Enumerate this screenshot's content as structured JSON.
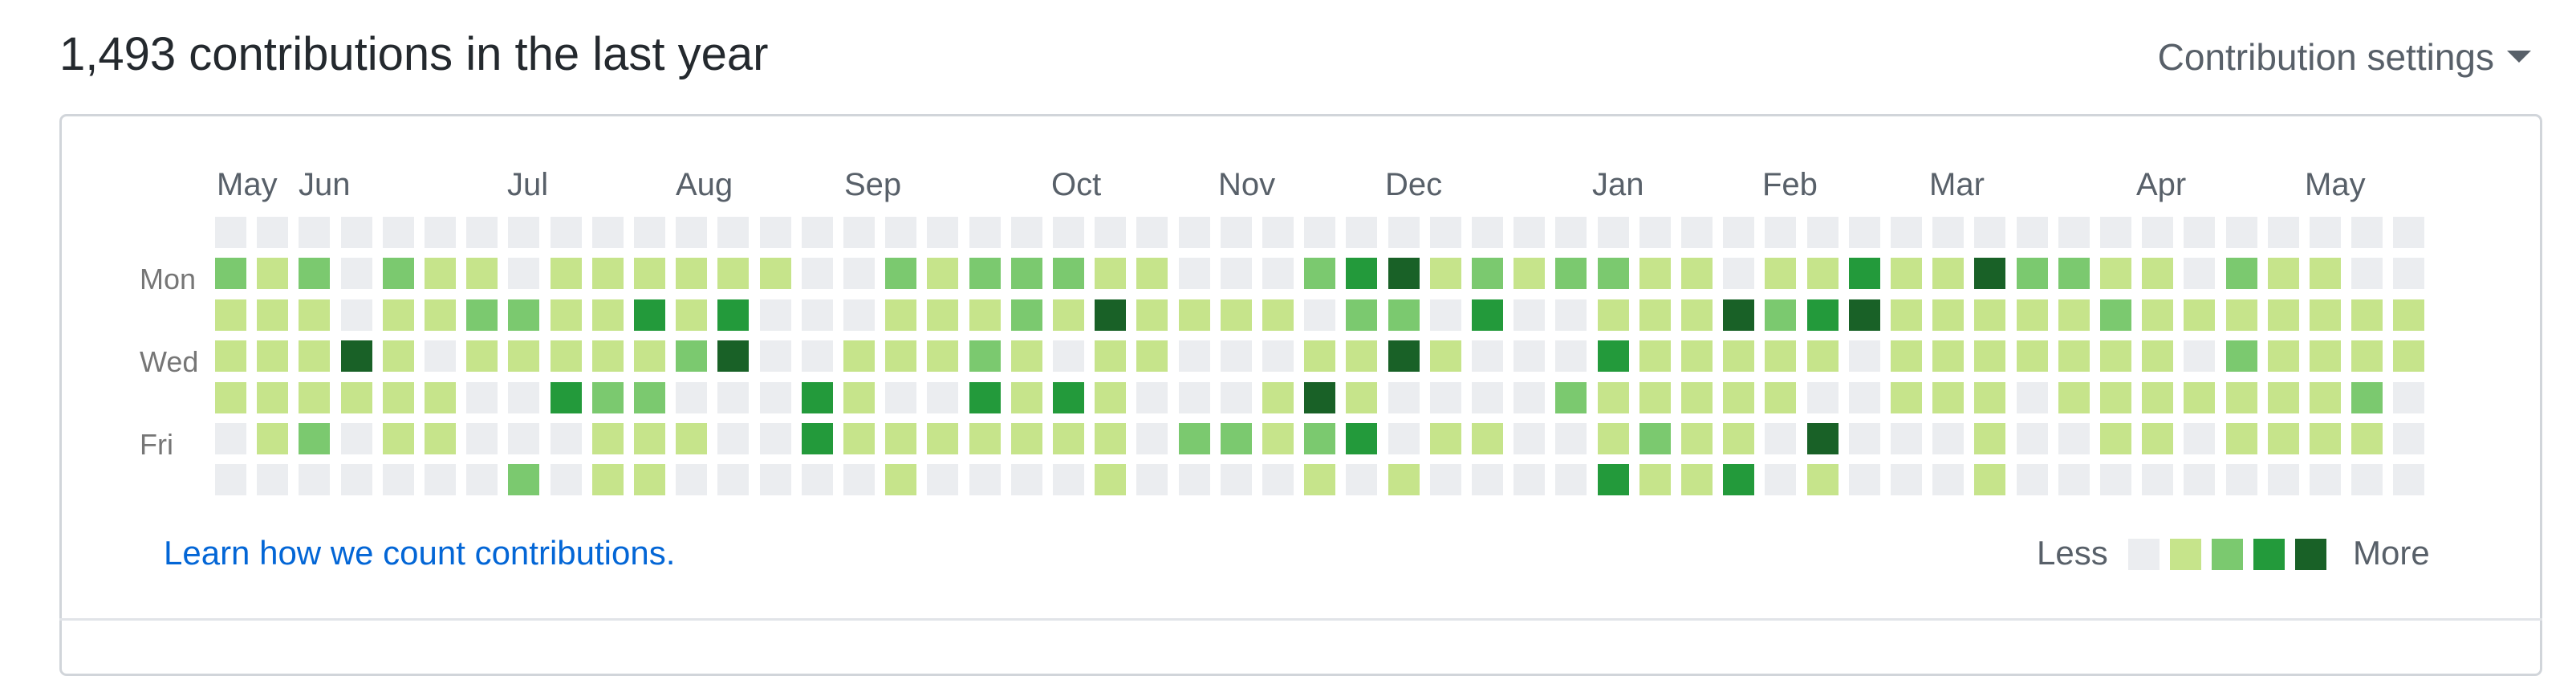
{
  "header": {
    "title": "1,493 contributions in the last year",
    "settings_label": "Contribution settings"
  },
  "calendar": {
    "months": [
      "May",
      "Jun",
      "Jul",
      "Aug",
      "Sep",
      "Oct",
      "Nov",
      "Dec",
      "Jan",
      "Feb",
      "Mar",
      "Apr",
      "May"
    ],
    "day_labels": [
      "Mon",
      "Wed",
      "Fri"
    ],
    "colors": [
      "#ebedf0",
      "#c6e48b",
      "#7bc96f",
      "#239a3b",
      "#196127"
    ],
    "levels": [
      [
        0,
        0,
        0,
        0,
        0,
        0,
        0,
        0,
        0,
        0,
        0,
        0,
        0,
        0,
        0,
        0,
        0,
        0,
        0,
        0,
        0,
        0,
        0,
        0,
        0,
        0,
        0,
        0,
        0,
        0,
        0,
        0,
        0,
        0,
        0,
        0,
        0,
        0,
        0,
        0,
        0,
        0,
        0,
        0,
        0,
        0,
        0,
        0,
        0,
        0,
        0,
        0,
        0
      ],
      [
        2,
        1,
        2,
        0,
        2,
        1,
        1,
        0,
        1,
        1,
        1,
        1,
        1,
        1,
        0,
        0,
        2,
        1,
        2,
        2,
        2,
        1,
        1,
        0,
        0,
        0,
        2,
        3,
        4,
        1,
        2,
        1,
        2,
        2,
        1,
        1,
        0,
        1,
        1,
        3,
        1,
        1,
        4,
        2,
        2,
        1,
        1,
        0,
        2,
        1,
        1,
        0,
        0
      ],
      [
        1,
        1,
        1,
        0,
        1,
        1,
        2,
        2,
        1,
        1,
        3,
        1,
        3,
        0,
        0,
        0,
        1,
        1,
        1,
        2,
        1,
        4,
        1,
        1,
        1,
        1,
        0,
        2,
        2,
        0,
        3,
        0,
        0,
        1,
        1,
        1,
        4,
        2,
        3,
        4,
        1,
        1,
        1,
        1,
        1,
        2,
        1,
        1,
        1,
        1,
        1,
        1,
        1
      ],
      [
        1,
        1,
        1,
        4,
        1,
        0,
        1,
        1,
        1,
        1,
        1,
        2,
        4,
        0,
        0,
        1,
        1,
        1,
        2,
        1,
        0,
        1,
        1,
        0,
        0,
        0,
        1,
        1,
        4,
        1,
        0,
        0,
        0,
        3,
        1,
        1,
        1,
        1,
        1,
        0,
        1,
        1,
        1,
        1,
        1,
        1,
        1,
        0,
        2,
        1,
        1,
        1,
        1
      ],
      [
        1,
        1,
        1,
        1,
        1,
        1,
        0,
        0,
        3,
        2,
        2,
        0,
        0,
        0,
        3,
        1,
        0,
        0,
        3,
        1,
        3,
        1,
        0,
        0,
        0,
        1,
        4,
        1,
        0,
        0,
        0,
        0,
        2,
        1,
        1,
        1,
        1,
        1,
        0,
        0,
        1,
        1,
        1,
        0,
        1,
        1,
        1,
        1,
        1,
        1,
        1,
        2,
        0
      ],
      [
        0,
        1,
        2,
        0,
        1,
        1,
        0,
        0,
        0,
        1,
        1,
        1,
        0,
        0,
        3,
        1,
        1,
        1,
        1,
        1,
        1,
        1,
        0,
        2,
        2,
        1,
        2,
        3,
        0,
        1,
        1,
        0,
        0,
        1,
        2,
        1,
        1,
        0,
        4,
        0,
        0,
        0,
        1,
        0,
        0,
        1,
        1,
        0,
        1,
        1,
        1,
        1,
        0
      ],
      [
        0,
        0,
        0,
        0,
        0,
        0,
        0,
        2,
        0,
        1,
        1,
        0,
        0,
        0,
        0,
        0,
        1,
        0,
        0,
        0,
        0,
        1,
        0,
        0,
        0,
        0,
        1,
        0,
        1,
        0,
        0,
        0,
        0,
        3,
        1,
        1,
        3,
        0,
        1,
        0,
        0,
        0,
        1,
        0,
        0,
        0,
        0,
        0,
        0,
        0,
        0,
        0,
        0
      ]
    ]
  },
  "footer": {
    "learn_link": "Learn how we count contributions.",
    "legend_less": "Less",
    "legend_more": "More"
  }
}
